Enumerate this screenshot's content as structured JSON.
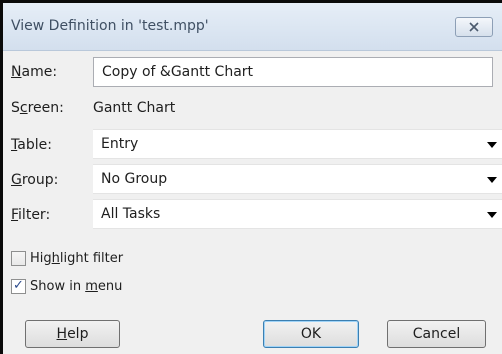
{
  "window": {
    "title": "View Definition in 'test.mpp'",
    "close_icon": "close-icon"
  },
  "fields": {
    "name_label_pre": "",
    "name_label_key": "N",
    "name_label_post": "ame:",
    "name_value": "Copy of &Gantt Chart",
    "screen_label_pre": "S",
    "screen_label_key": "c",
    "screen_label_post": "reen:",
    "screen_value": "Gantt Chart",
    "table_label_pre": "",
    "table_label_key": "T",
    "table_label_post": "able:",
    "table_value": "Entry",
    "group_label_pre": "",
    "group_label_key": "G",
    "group_label_post": "roup:",
    "group_value": "No Group",
    "filter_label_pre": "",
    "filter_label_key": "F",
    "filter_label_post": "ilter:",
    "filter_value": "All Tasks"
  },
  "options": {
    "highlight_pre": "Hig",
    "highlight_key": "h",
    "highlight_post": "light filter",
    "highlight_checked": false,
    "menu_pre": "Show in ",
    "menu_key": "m",
    "menu_post": "enu",
    "menu_checked": true
  },
  "buttons": {
    "help_key": "H",
    "help_post": "elp",
    "ok": "OK",
    "cancel": "Cancel"
  }
}
